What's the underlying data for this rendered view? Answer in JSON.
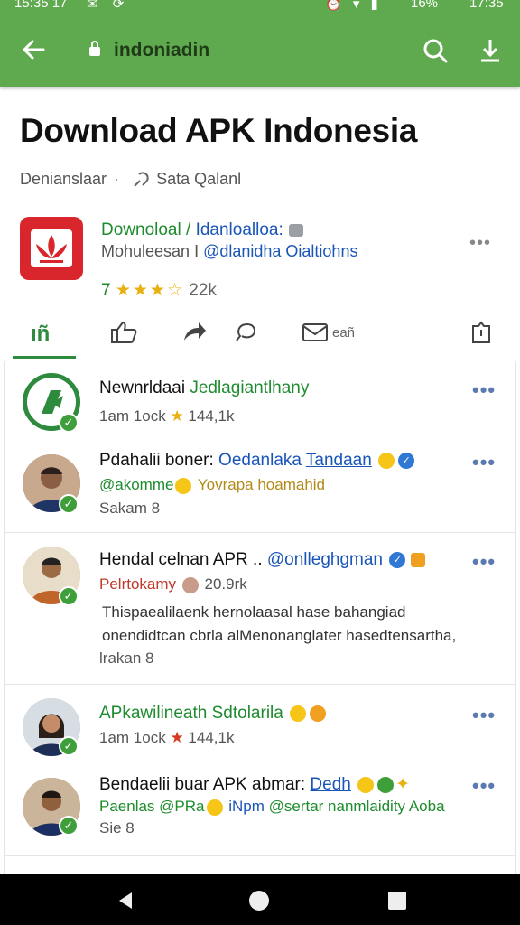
{
  "status": {
    "time_left": "15:35 17",
    "time_right": "17:35",
    "battery": "16%",
    "icons": [
      "mail-icon",
      "sync-icon",
      "alarm-icon",
      "wifi-icon",
      "signal-icon"
    ]
  },
  "appbar": {
    "url": "indoniadin",
    "icons": [
      "back-arrow-icon",
      "lock-icon",
      "search-icon",
      "download-icon"
    ]
  },
  "page": {
    "title": "Download APK Indonesia",
    "sub_left": "Denianslaar",
    "sub_right": "Sata Qalanl"
  },
  "app": {
    "name_green": "Downoloal / ",
    "name_blue": "Idanloalloa:",
    "dev_gray": "Mohuleesan I ",
    "dev_blue": "@dlanidha Oialtiohns",
    "rating_num": "7",
    "stars": "★★★☆",
    "rating_count": "22k",
    "colors": {
      "icon_bg": "#d8262c",
      "accent_green": "#1e8c2e",
      "link_blue": "#1a55b8"
    }
  },
  "actions": {
    "items": [
      {
        "name": "like-tab",
        "label": ""
      },
      {
        "name": "thumbs-up",
        "label": ""
      },
      {
        "name": "share",
        "label": ""
      },
      {
        "name": "comment",
        "label": ""
      },
      {
        "name": "mail",
        "label": "eañ"
      },
      {
        "name": "save",
        "label": ""
      }
    ]
  },
  "feed": [
    {
      "line1_a": "Newnrldaai ",
      "line1_b": "Jedlagiantlhany",
      "line2": "1am 1ock",
      "line2_star": "★",
      "line2_count": "144,1k"
    },
    {
      "line1_a": "Pdahalii boner: ",
      "line1_b": "Oedanlaka ",
      "line1_c": "Tandaan",
      "line2_a": "@akomme",
      "line2_b": " Yovrapa hoamahid",
      "line3": "Sakam 8"
    },
    {
      "line1_a": "Hendal celnan APR .. ",
      "line1_b": "@onlleghgman",
      "line2_a": "Pelrtokamy",
      "line2_b": "20.9rk",
      "body1": "Thispaealilaenk hernolaasal hase bahangiad",
      "body2": "onendidtcan cbrla alMenonanglater hasedtensartha,",
      "line3": "lrakan 8"
    },
    {
      "line1": "APkawilineath Sdtolarila",
      "line2": "1am 1ock",
      "line2_star": "★",
      "line2_count": "144,1k"
    },
    {
      "line1_a": "Bendaelii buar APK abmar: ",
      "line1_b": "Dedh",
      "line2_a": "Paenlas @PRa",
      "line2_b": " iNpm ",
      "line2_c": "@sertar nanmlaidity Aoba",
      "line3": "Sie 8"
    }
  ],
  "nav": {
    "icons": [
      "back-triangle-icon",
      "home-circle-icon",
      "recents-square-icon"
    ]
  }
}
